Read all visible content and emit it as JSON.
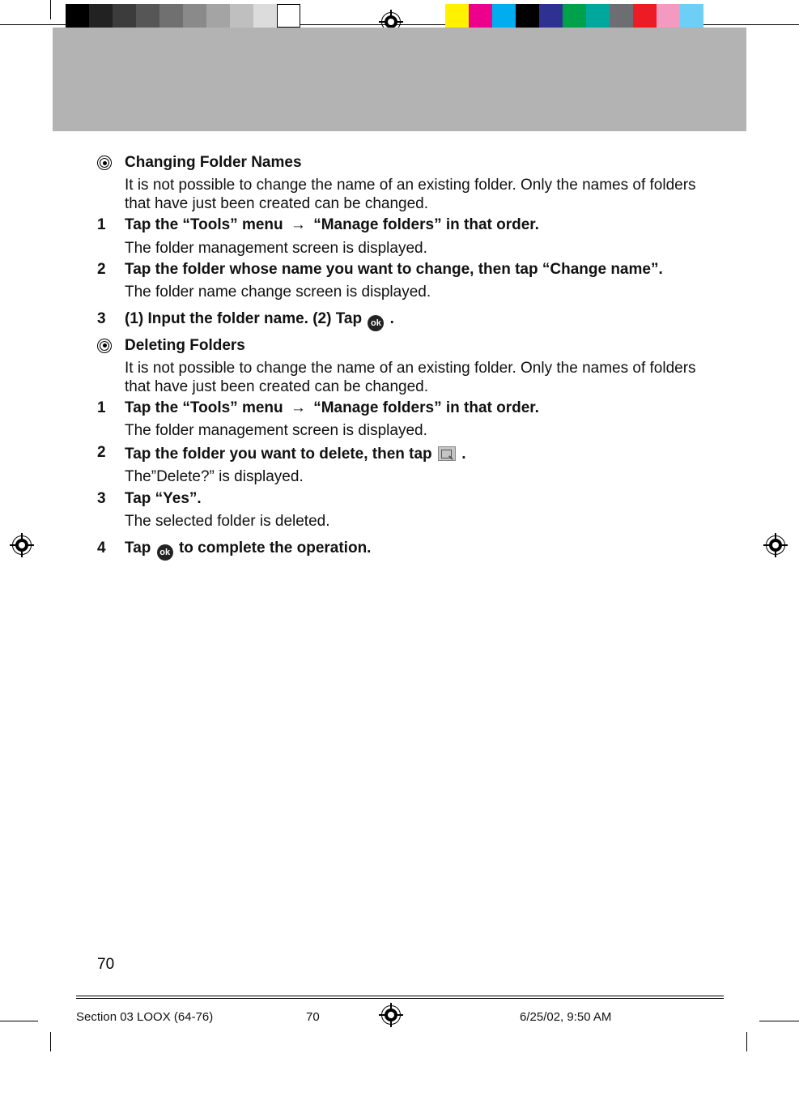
{
  "sections": [
    {
      "title": "Changing Folder Names",
      "intro": "It is not possible to change the name of an existing folder. Only the names of folders that have just been created can be changed.",
      "steps": [
        {
          "n": "1",
          "bold_pre": "Tap the “Tools” menu ",
          "bold_post": " “Manage folders” in that order.",
          "has_arrow": true,
          "plain": "The folder management screen is displayed."
        },
        {
          "n": "2",
          "bold": "Tap the folder whose name you want to change, then tap “Change name”.",
          "plain": "The folder name change screen is displayed."
        },
        {
          "n": "3",
          "bold_pre": "(1) Input the folder name. (2) Tap",
          "ok_after": true,
          "bold_post": " ."
        }
      ]
    },
    {
      "title": "Deleting Folders",
      "intro": "It is not possible to change the name of an existing folder. Only the names of folders that have just been created can be changed.",
      "steps": [
        {
          "n": "1",
          "bold_pre": "Tap the “Tools” menu ",
          "bold_post": " “Manage folders” in that order.",
          "has_arrow": true,
          "plain": "The folder management screen is displayed."
        },
        {
          "n": "2",
          "bold_pre": "Tap the folder you want to delete, then tap",
          "del_after": true,
          "bold_post": " .",
          "plain": "The”Delete?” is displayed."
        },
        {
          "n": "3",
          "bold": "Tap “Yes”.",
          "plain": "The selected folder is deleted."
        },
        {
          "n": "4",
          "bold_pre": "Tap",
          "ok_after": true,
          "bold_post": "  to complete the operation."
        }
      ]
    }
  ],
  "inline": {
    "arrow": "→",
    "ok": "ok"
  },
  "page_number": "70",
  "footer": {
    "section": "Section 03 LOOX (64-76)",
    "page": "70",
    "date": "6/25/02, 9:50 AM"
  }
}
